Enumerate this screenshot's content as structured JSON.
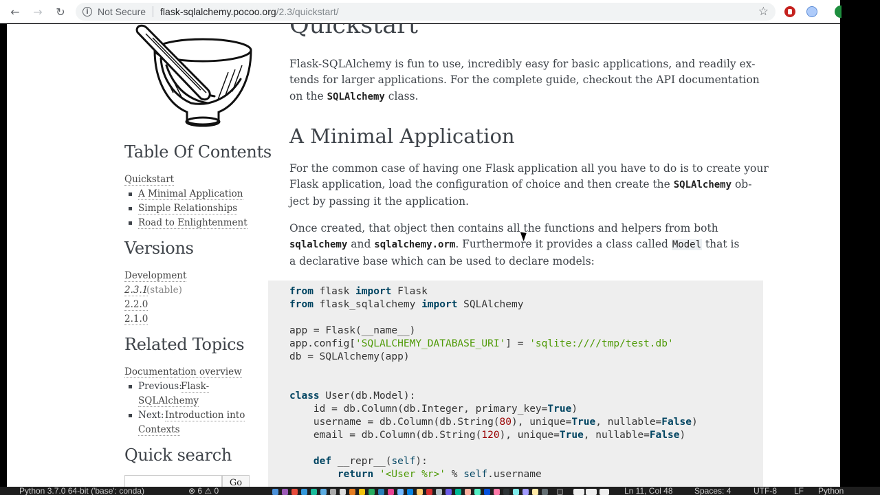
{
  "browser": {
    "back_icon": "←",
    "forward_icon": "→",
    "reload_icon": "↻",
    "info_icon": "i",
    "security_label": "Not Secure",
    "url_host": "flask-sqlalchemy.pocoo.org",
    "url_path": "/2.3/quickstart/",
    "star_icon": "☆"
  },
  "sidebar": {
    "toc_heading": "Table Of Contents",
    "toc_root": "Quickstart",
    "toc_items": [
      "A Minimal Application",
      "Simple Relationships",
      "Road to Enlightenment"
    ],
    "versions_heading": "Versions",
    "versions_dev": "Development",
    "versions": [
      {
        "label": "2.3.1",
        "note": "(stable)"
      },
      {
        "label": "2.2.0"
      },
      {
        "label": "2.1.0"
      }
    ],
    "related_heading": "Related Topics",
    "related_root": "Documentation overview",
    "prev_label": "Previous:",
    "prev_link_1": "Flask-",
    "prev_link_2": "SQLAlchemy",
    "next_label": "Next:",
    "next_link_1": "Introduction into",
    "next_link_2": "Contexts",
    "search_heading": "Quick search",
    "search_button": "Go"
  },
  "main": {
    "title": "Quickstart",
    "intro_l1": "Flask-SQLAlchemy is fun to use, incredibly easy for basic applications, and readily ex-",
    "intro_l2": "tends for larger applications. For the complete guide, checkout the API documentation",
    "intro_l3a": "on the ",
    "intro_l3_code": "SQLAlchemy",
    "intro_l3b": " class.",
    "h2": "A Minimal Application",
    "p2_l1": "For the common case of having one Flask application all you have to do is to create your",
    "p2_l2a": "Flask application, load the configuration of choice and then create the ",
    "p2_l2_code": "SQLAlchemy",
    "p2_l2b": " ob-",
    "p2_l3": "ject by passing it the application.",
    "p3_l1": "Once created, that object then contains all the functions and helpers from both",
    "p3_l2_code1": "sqlalchemy",
    "p3_l2_and": " and ",
    "p3_l2_code2": "sqlalchemy.orm",
    "p3_l2b": ". Furthermore it provides a class called ",
    "p3_l2_code3": "Model",
    "p3_l2c": " that is",
    "p3_l3": "a declarative base which can be used to declare models:"
  },
  "code": {
    "l1_kw1": "from",
    "l1_mod": " flask ",
    "l1_kw2": "import",
    "l1_name": " Flask",
    "l2_kw1": "from",
    "l2_mod": " flask_sqlalchemy ",
    "l2_kw2": "import",
    "l2_name": " SQLAlchemy",
    "l4": "app = Flask(__name__)",
    "l5a": "app.config[",
    "l5_str1": "'SQLALCHEMY_DATABASE_URI'",
    "l5b": "] = ",
    "l5_str2": "'sqlite:////tmp/test.db'",
    "l6": "db = SQLAlchemy(app)",
    "l9_kw": "class",
    "l9_rest": " User(db.Model):",
    "l10a": "    id = db.Column(db.Integer, primary_key=",
    "l10_true": "True",
    "l10b": ")",
    "l11a": "    username = db.Column(db.String(",
    "l11_num": "80",
    "l11b": "), unique=",
    "l11_true": "True",
    "l11c": ", nullable=",
    "l11_false": "False",
    "l11d": ")",
    "l12a": "    email = db.Column(db.String(",
    "l12_num": "120",
    "l12b": "), unique=",
    "l12_true": "True",
    "l12c": ", nullable=",
    "l12_false": "False",
    "l12d": ")",
    "l14_indent": "    ",
    "l14_kw": "def",
    "l14_mid": " __repr__(",
    "l14_self": "self",
    "l14_end": "):",
    "l15_indent": "        ",
    "l15_kw": "return",
    "l15_sp": " ",
    "l15_str": "'<User %r>'",
    "l15_mid": " % ",
    "l15_self": "self",
    "l15_end": ".username"
  },
  "statusbar": {
    "left": "Python 3.7.0 64-bit ('base': conda)",
    "problems": "⊗ 6 ⚠ 0",
    "position": "Ln 11, Col 48",
    "spaces": "Spaces: 4",
    "encoding": "UTF-8",
    "eol": "LF",
    "language": "Python"
  }
}
